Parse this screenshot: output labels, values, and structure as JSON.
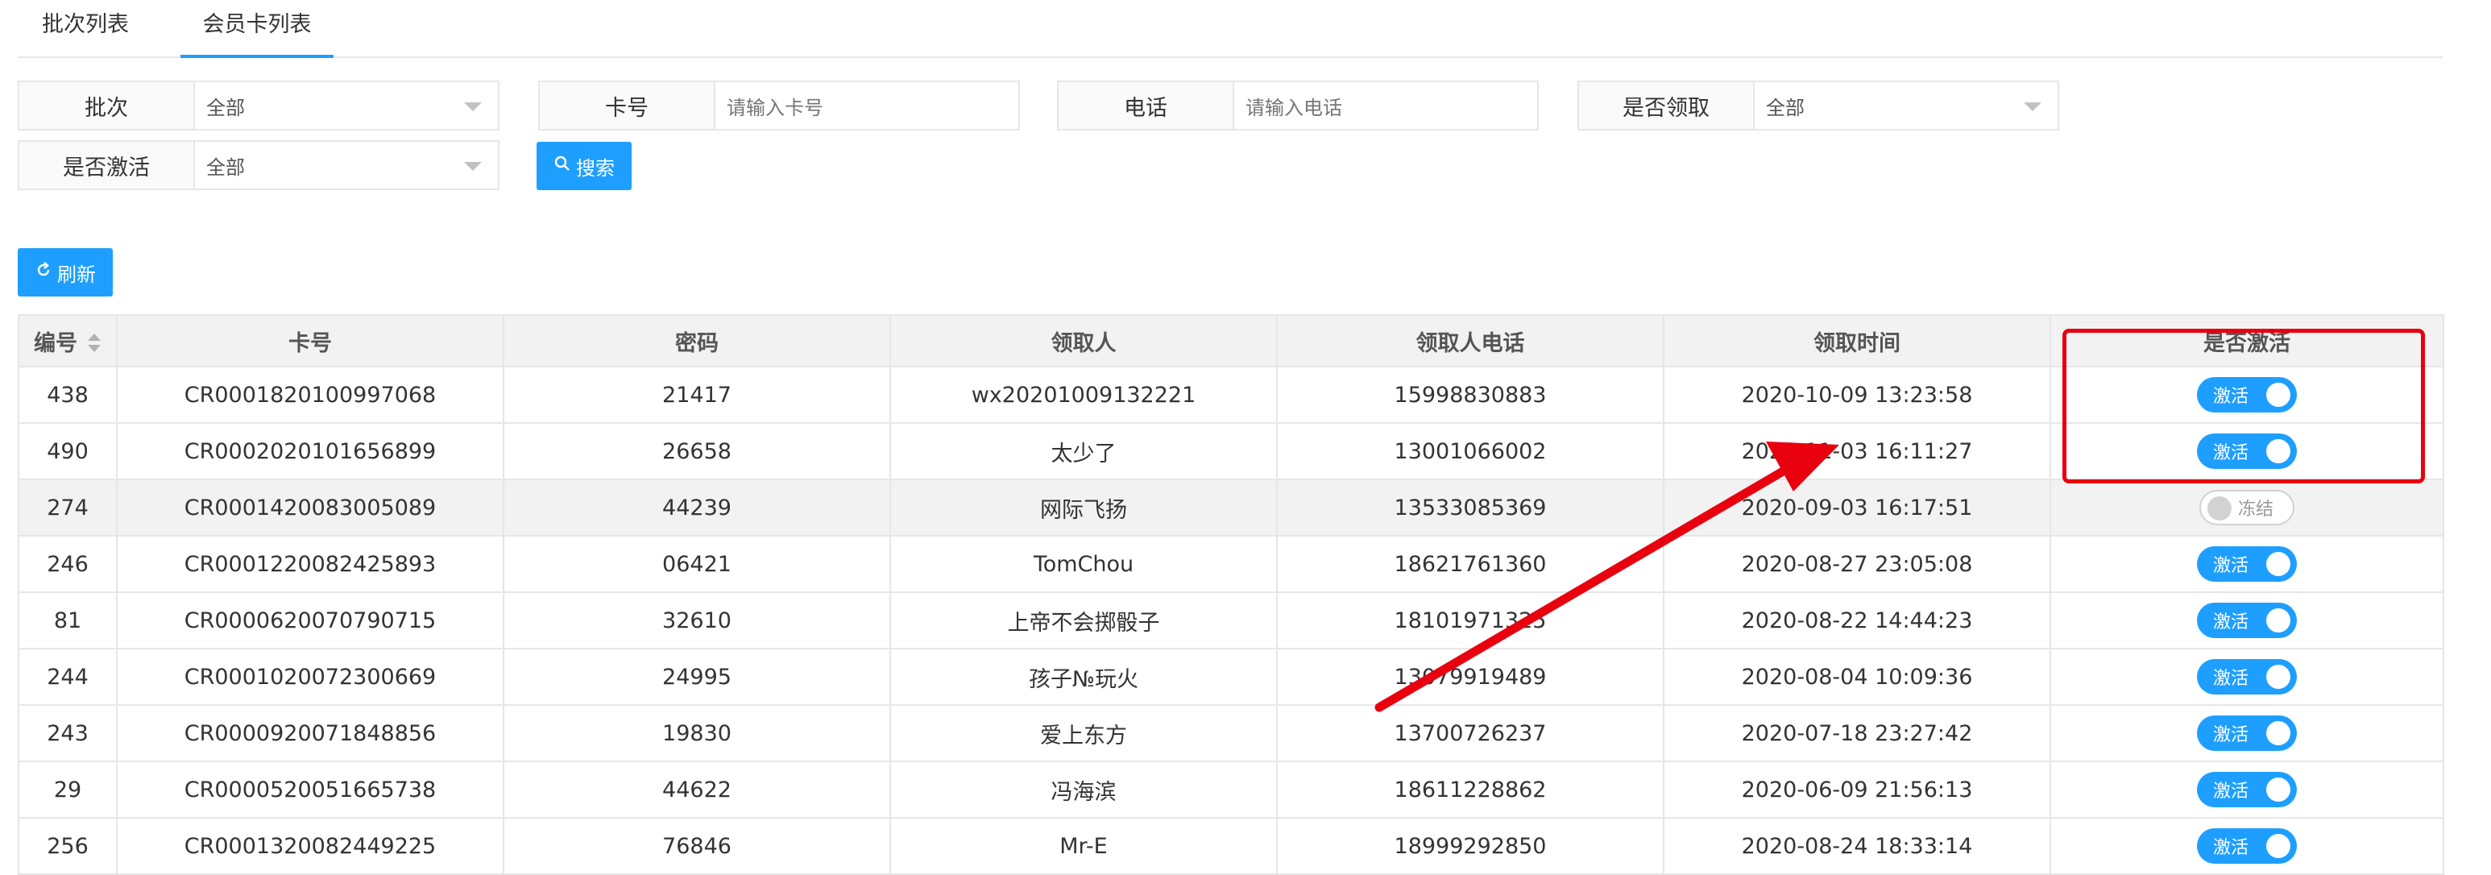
{
  "tabs": [
    {
      "label": "批次列表",
      "active": false
    },
    {
      "label": "会员卡列表",
      "active": true
    }
  ],
  "filters": {
    "batch": {
      "label": "批次",
      "value": "全部"
    },
    "card_no": {
      "label": "卡号",
      "placeholder": "请输入卡号"
    },
    "phone": {
      "label": "电话",
      "placeholder": "请输入电话"
    },
    "claimed": {
      "label": "是否领取",
      "value": "全部"
    },
    "activated": {
      "label": "是否激活",
      "value": "全部"
    },
    "search_label": "搜索"
  },
  "refresh_label": "刷新",
  "table": {
    "headers": [
      "编号",
      "卡号",
      "密码",
      "领取人",
      "领取人电话",
      "领取时间",
      "是否激活"
    ],
    "rows": [
      {
        "id": "438",
        "card": "CR0001820100997068",
        "pwd": "21417",
        "owner": "wx20201009132221",
        "phone": "15998830883",
        "time": "2020-10-09 13:23:58",
        "status": "激活",
        "on": true
      },
      {
        "id": "490",
        "card": "CR0002020101656899",
        "pwd": "26658",
        "owner": "太少了",
        "phone": "13001066002",
        "time": "2020-11-03 16:11:27",
        "status": "激活",
        "on": true
      },
      {
        "id": "274",
        "card": "CR0001420083005089",
        "pwd": "44239",
        "owner": "网际飞扬",
        "phone": "13533085369",
        "time": "2020-09-03 16:17:51",
        "status": "冻结",
        "on": false
      },
      {
        "id": "246",
        "card": "CR0001220082425893",
        "pwd": "06421",
        "owner": "TomChou",
        "phone": "18621761360",
        "time": "2020-08-27 23:05:08",
        "status": "激活",
        "on": true
      },
      {
        "id": "81",
        "card": "CR0000620070790715",
        "pwd": "32610",
        "owner": "上帝不会掷骰子",
        "phone": "18101971325",
        "time": "2020-08-22 14:44:23",
        "status": "激活",
        "on": true
      },
      {
        "id": "244",
        "card": "CR0001020072300669",
        "pwd": "24995",
        "owner": "孩子№玩火",
        "phone": "13079919489",
        "time": "2020-08-04 10:09:36",
        "status": "激活",
        "on": true
      },
      {
        "id": "243",
        "card": "CR0000920071848856",
        "pwd": "19830",
        "owner": "爱上东方",
        "phone": "13700726237",
        "time": "2020-07-18 23:27:42",
        "status": "激活",
        "on": true
      },
      {
        "id": "29",
        "card": "CR0000520051665738",
        "pwd": "44622",
        "owner": "冯海滨",
        "phone": "18611228862",
        "time": "2020-06-09 21:56:13",
        "status": "激活",
        "on": true
      },
      {
        "id": "256",
        "card": "CR0001320082449225",
        "pwd": "76846",
        "owner": "Mr-E",
        "phone": "18999292850",
        "time": "2020-08-24 18:33:14",
        "status": "激活",
        "on": true
      }
    ]
  },
  "colors": {
    "accent": "#1e9fff",
    "annotation": "#e8000f"
  }
}
